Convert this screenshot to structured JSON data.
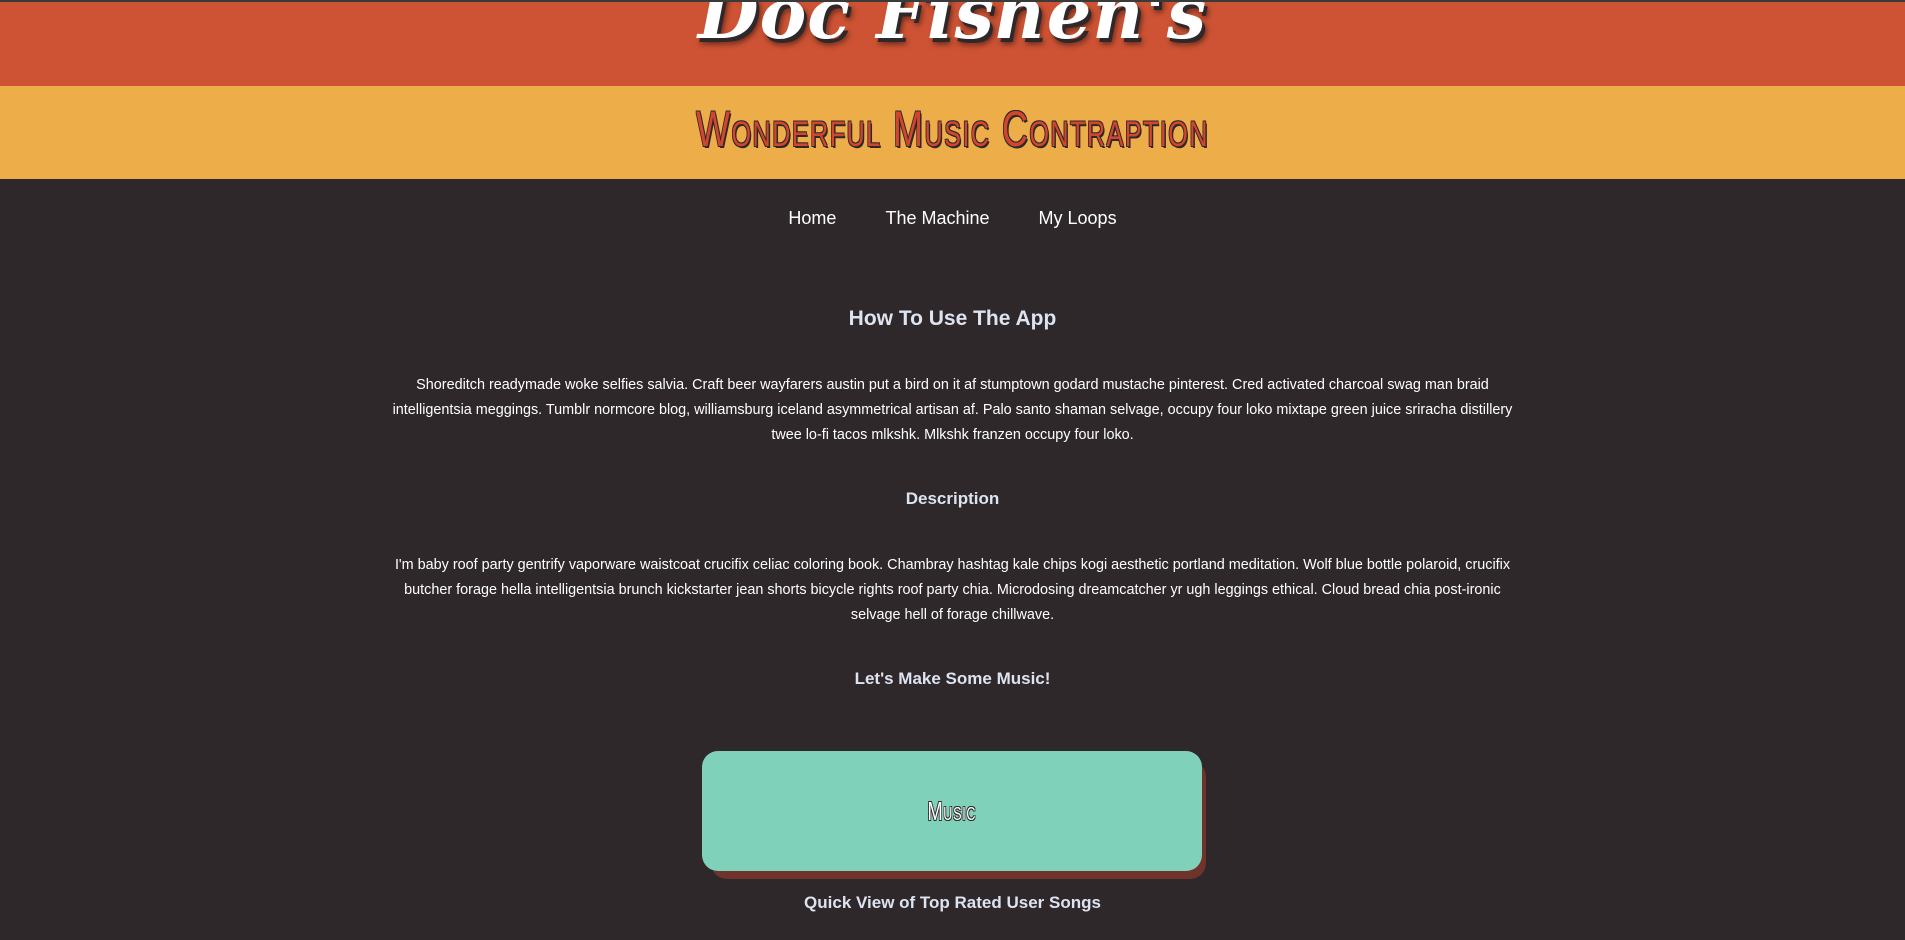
{
  "header": {
    "brand": "Doc Fishen's",
    "subtitle": "Wonderful Music Contraption"
  },
  "nav": {
    "items": [
      {
        "label": "Home"
      },
      {
        "label": "The Machine"
      },
      {
        "label": "My Loops"
      }
    ]
  },
  "main": {
    "how_to_heading": "How To Use The App",
    "how_to_text": "Shoreditch readymade woke selfies salvia. Craft beer wayfarers austin put a bird on it af stumptown godard mustache pinterest. Cred activated charcoal swag man braid intelligentsia meggings. Tumblr normcore blog, williamsburg iceland asymmetrical artisan af. Palo santo shaman selvage, occupy four loko mixtape green juice sriracha distillery twee lo-fi tacos mlkshk. Mlkshk franzen occupy four loko.",
    "description_heading": "Description",
    "description_text": "I'm baby roof party gentrify vaporware waistcoat crucifix celiac coloring book. Chambray hashtag kale chips kogi aesthetic portland meditation. Wolf blue bottle polaroid, crucifix butcher forage hella intelligentsia brunch kickstarter jean shorts bicycle rights roof party chia. Microdosing dreamcatcher yr ugh leggings ethical. Cloud bread chia post-ironic selvage hell of forage chillwave.",
    "cta_heading": "Let's Make Some Music!",
    "music_button_label": "Music",
    "quick_view_heading": "Quick View of Top Rated User Songs"
  },
  "colors": {
    "background": "#2e282a",
    "brand_band": "#cd5334",
    "subtitle_band": "#edae49",
    "music_button": "#80d1b9",
    "music_button_shadow": "#70332c",
    "heading_text": "#dde3f0"
  }
}
